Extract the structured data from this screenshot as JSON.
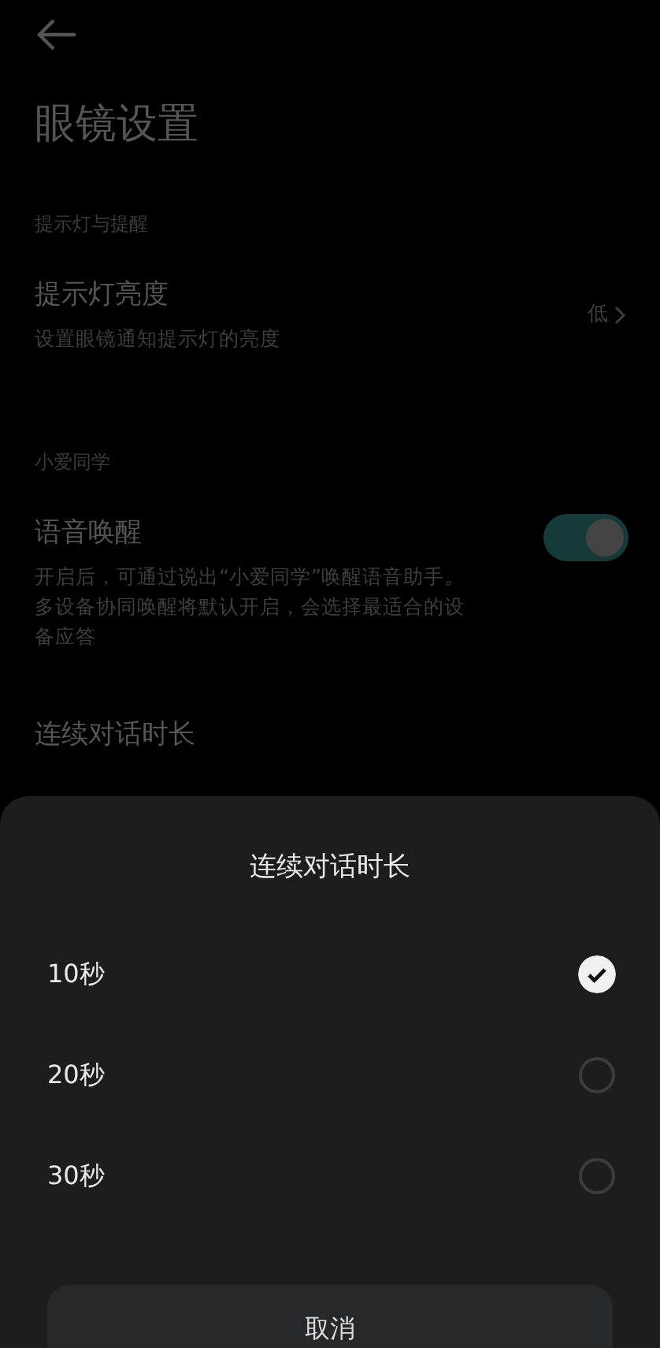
{
  "page": {
    "title": "眼镜设置"
  },
  "sections": [
    {
      "header": "提示灯与提醒",
      "items": [
        {
          "kind": "value",
          "title": "提示灯亮度",
          "subtitle": "设置眼镜通知提示灯的亮度",
          "value": "低"
        }
      ]
    },
    {
      "header": "小爱同学",
      "items": [
        {
          "kind": "toggle",
          "title": "语音唤醒",
          "subtitle": "开启后，可通过说出“小爱同学”唤醒语音助手。多设备协同唤醒将默认开启，会选择最适合的设备应答",
          "on": true
        },
        {
          "kind": "plain",
          "title": "连续对话时长"
        }
      ]
    }
  ],
  "sheet": {
    "title": "连续对话时长",
    "options": [
      {
        "label": "10秒",
        "selected": true
      },
      {
        "label": "20秒",
        "selected": false
      },
      {
        "label": "30秒",
        "selected": false
      }
    ],
    "cancel": "取消"
  }
}
